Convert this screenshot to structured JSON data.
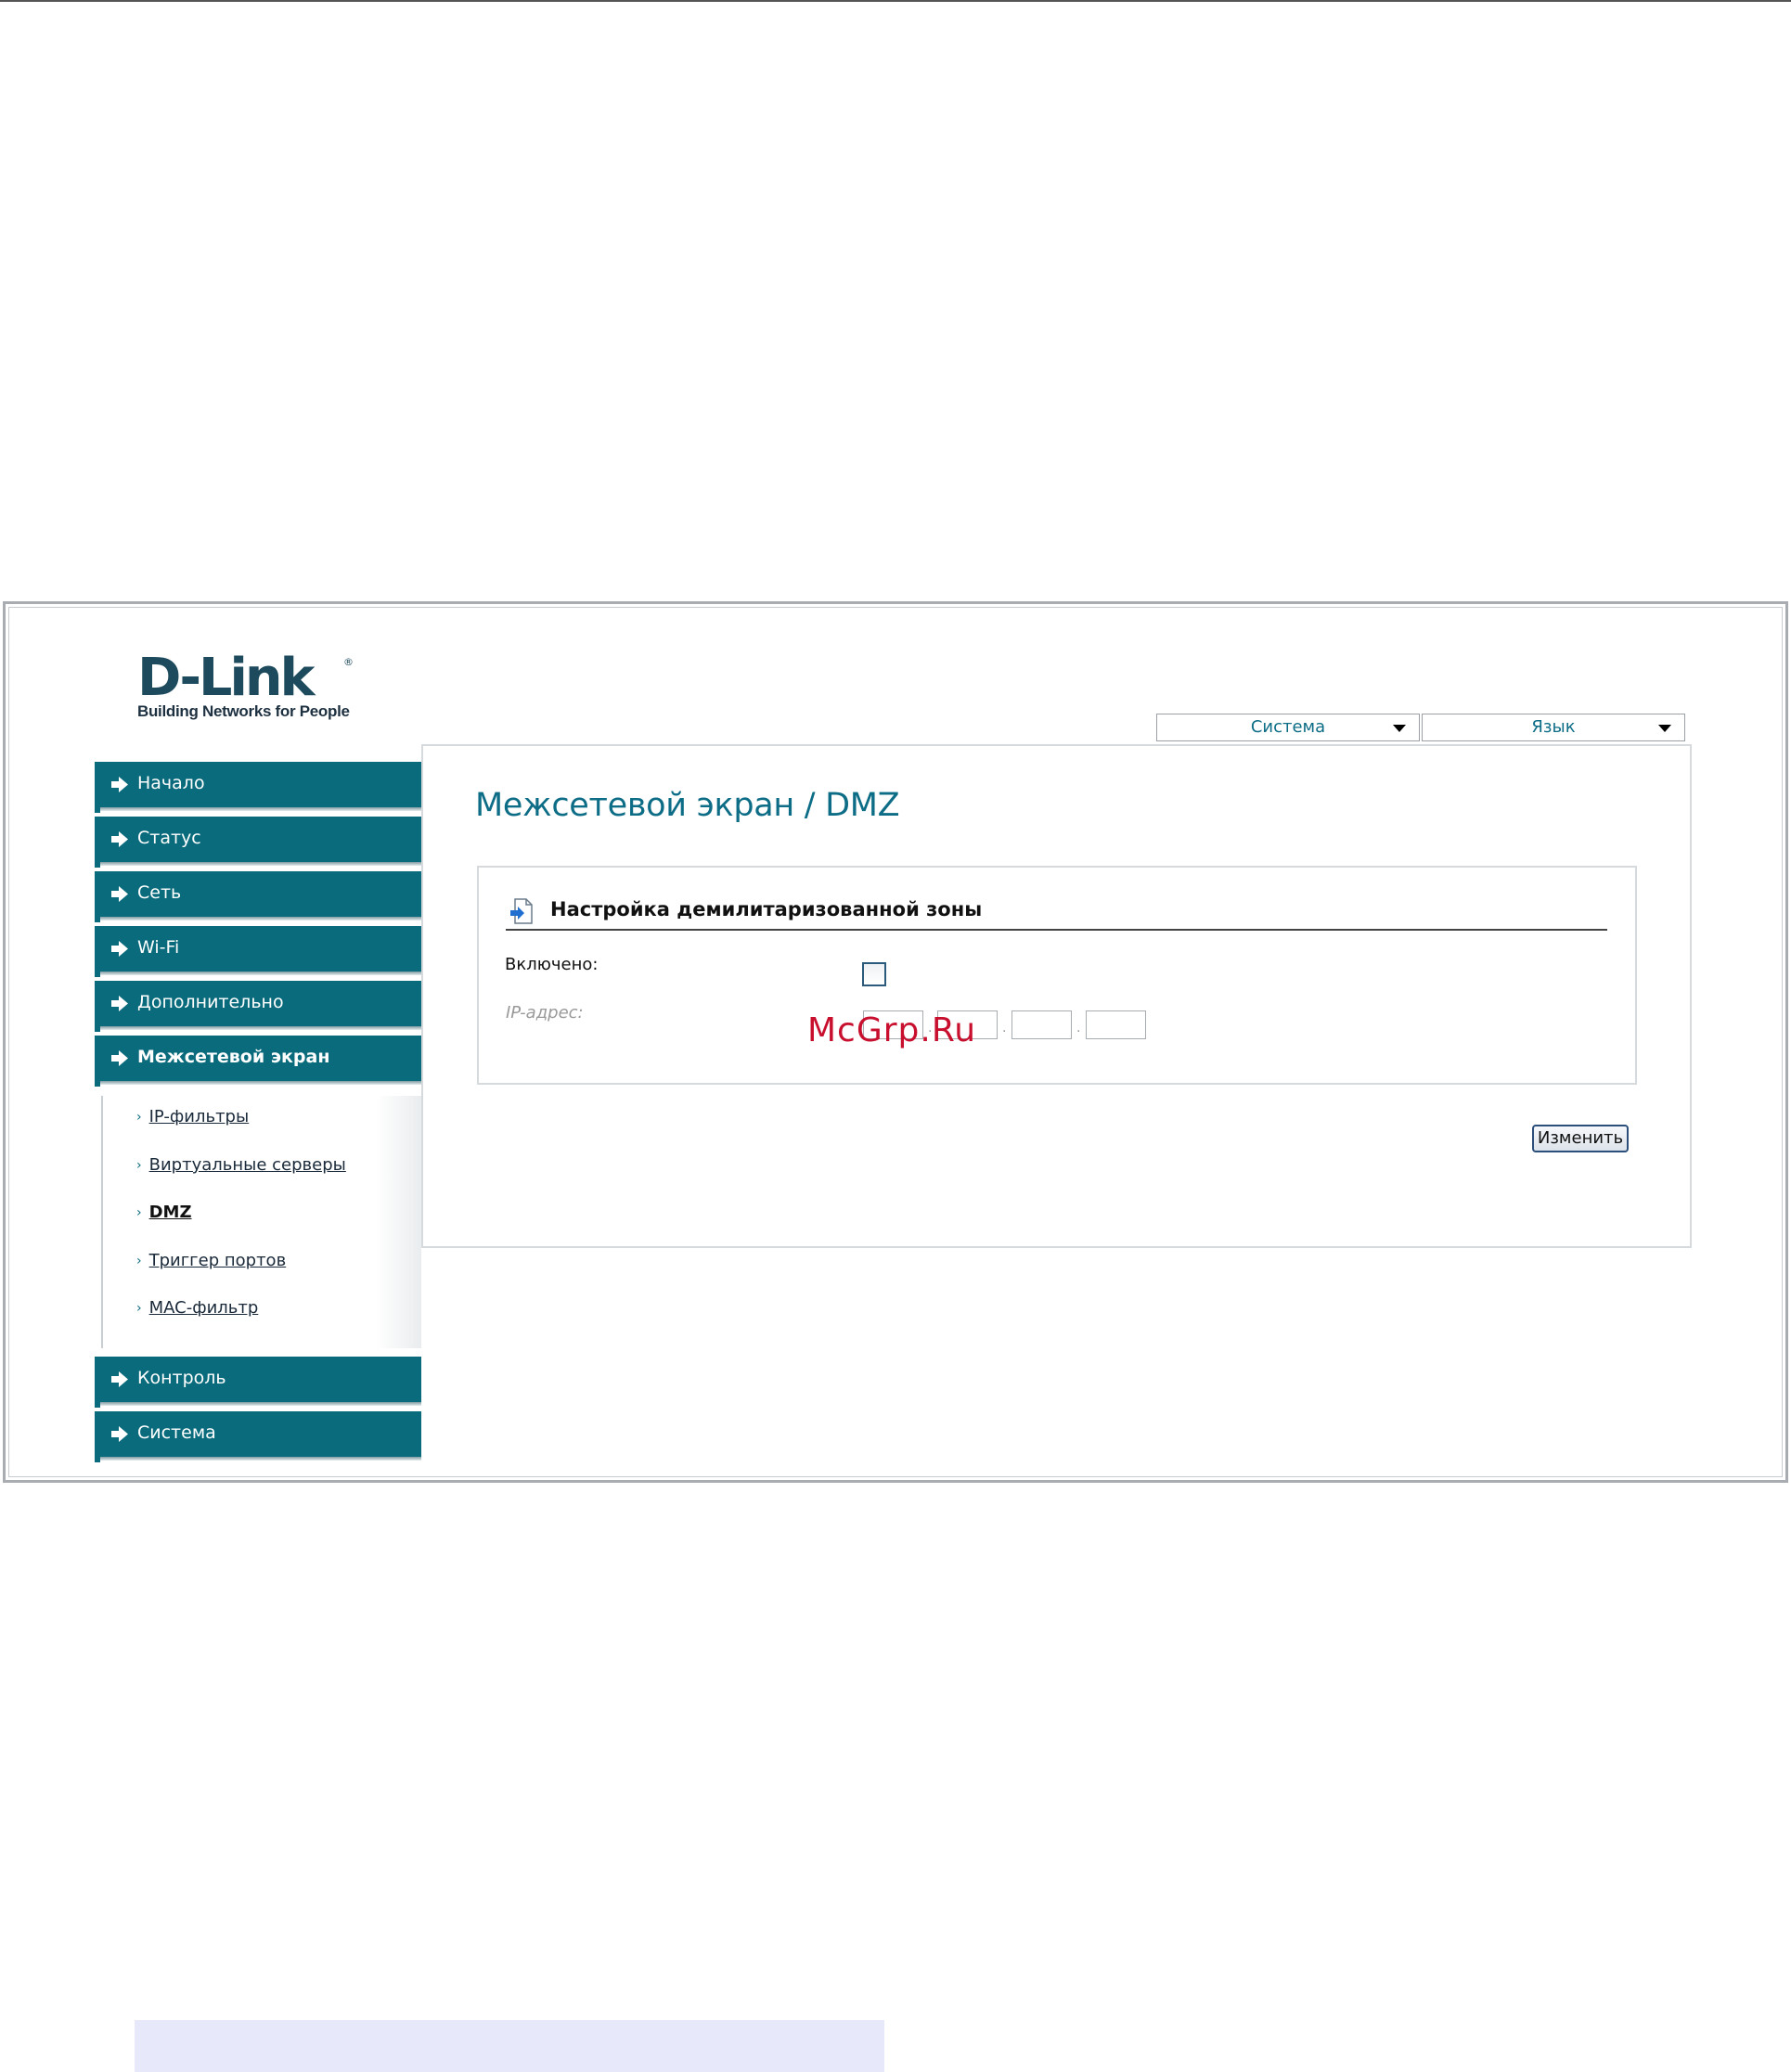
{
  "brand": {
    "logo_text": "D-Link",
    "logo_registered": "®",
    "tagline": "Building Networks for People"
  },
  "top_menu": {
    "system_label": "Система",
    "language_label": "Язык"
  },
  "sidebar": {
    "items": [
      {
        "label": "Начало"
      },
      {
        "label": "Статус"
      },
      {
        "label": "Сеть"
      },
      {
        "label": "Wi-Fi"
      },
      {
        "label": "Дополнительно"
      },
      {
        "label": "Межсетевой экран"
      },
      {
        "label": "Контроль"
      },
      {
        "label": "Система"
      }
    ],
    "active_index": 5,
    "submenu": [
      {
        "label": "IP-фильтры"
      },
      {
        "label": "Виртуальные серверы"
      },
      {
        "label": "DMZ"
      },
      {
        "label": "Триггер портов"
      },
      {
        "label": "MAC-фильтр"
      }
    ],
    "submenu_current_index": 2
  },
  "main": {
    "title": "Межсетевой экран / DMZ",
    "section_title": "Настройка демилитаризованной зоны",
    "enabled_label": "Включено:",
    "enabled_checked": false,
    "ip_label": "IP-адрес:",
    "ip_octets": [
      "",
      "",
      "",
      ""
    ],
    "change_button": "Изменить"
  },
  "watermark": "McGrp.Ru",
  "colors": {
    "accent": "#0a6b7c",
    "title": "#0d6d86",
    "watermark": "#c8102e"
  }
}
